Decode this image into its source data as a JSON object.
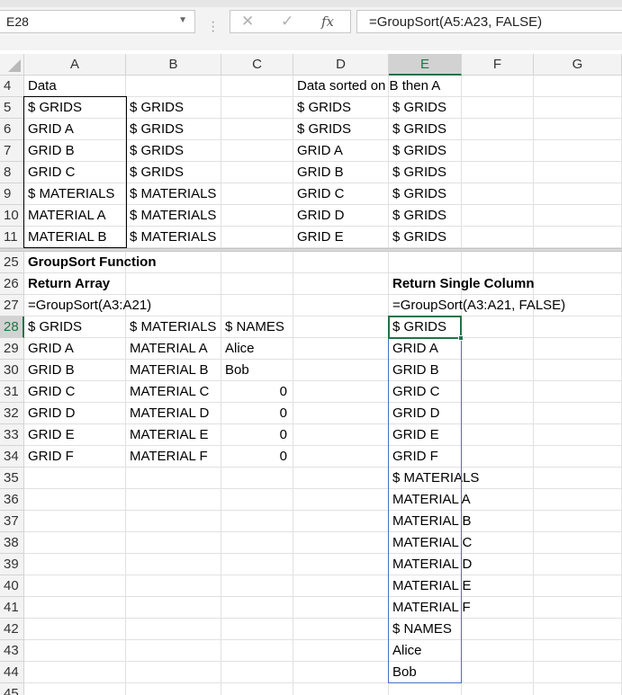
{
  "namebox": {
    "value": "E28"
  },
  "formula": {
    "text": "=GroupSort(A5:A23, FALSE)"
  },
  "toolbar": {
    "cancel": "✕",
    "enter": "✓",
    "fx": "fx"
  },
  "columns": [
    "A",
    "B",
    "C",
    "D",
    "E",
    "F",
    "G"
  ],
  "selected_column": "E",
  "selected_row": "28",
  "rows": {
    "r4": {
      "num": "4",
      "A": "Data",
      "D": "Data sorted on B then A"
    },
    "r5": {
      "num": "5",
      "A": "$ GRIDS",
      "B": "$ GRIDS",
      "D": "$ GRIDS",
      "E": "$ GRIDS"
    },
    "r6": {
      "num": "6",
      "A": "GRID A",
      "B": "$ GRIDS",
      "D": "$ GRIDS",
      "E": "$ GRIDS"
    },
    "r7": {
      "num": "7",
      "A": "GRID B",
      "B": "$ GRIDS",
      "D": "GRID A",
      "E": "$ GRIDS"
    },
    "r8": {
      "num": "8",
      "A": "GRID C",
      "B": "$ GRIDS",
      "D": "GRID B",
      "E": "$ GRIDS"
    },
    "r9": {
      "num": "9",
      "A": "$ MATERIALS",
      "B": "$ MATERIALS",
      "D": "GRID C",
      "E": "$ GRIDS"
    },
    "r10": {
      "num": "10",
      "A": "MATERIAL A",
      "B": "$ MATERIALS",
      "D": "GRID D",
      "E": "$ GRIDS"
    },
    "r11": {
      "num": "11",
      "A": "MATERIAL B",
      "B": "$ MATERIALS",
      "D": "GRID E",
      "E": "$ GRIDS"
    },
    "r25": {
      "num": "25",
      "A": "GroupSort Function"
    },
    "r26": {
      "num": "26",
      "A": "Return Array",
      "E": "Return Single Column"
    },
    "r27": {
      "num": "27",
      "A": " =GroupSort(A3:A21)",
      "E": "=GroupSort(A3:A21, FALSE)"
    },
    "r28": {
      "num": "28",
      "A": "$ GRIDS",
      "B": "$ MATERIALS",
      "C": "$ NAMES",
      "E": "$ GRIDS"
    },
    "r29": {
      "num": "29",
      "A": "GRID A",
      "B": "MATERIAL A",
      "C": "Alice",
      "E": "GRID A"
    },
    "r30": {
      "num": "30",
      "A": "GRID B",
      "B": "MATERIAL B",
      "C": "Bob",
      "E": "GRID B"
    },
    "r31": {
      "num": "31",
      "A": "GRID C",
      "B": "MATERIAL C",
      "C": "0",
      "E": "GRID C"
    },
    "r32": {
      "num": "32",
      "A": "GRID D",
      "B": "MATERIAL D",
      "C": "0",
      "E": "GRID D"
    },
    "r33": {
      "num": "33",
      "A": "GRID E",
      "B": "MATERIAL E",
      "C": "0",
      "E": "GRID E"
    },
    "r34": {
      "num": "34",
      "A": "GRID F",
      "B": "MATERIAL F",
      "C": "0",
      "E": "GRID F"
    },
    "r35": {
      "num": "35",
      "E": "$ MATERIALS"
    },
    "r36": {
      "num": "36",
      "E": "MATERIAL A"
    },
    "r37": {
      "num": "37",
      "E": "MATERIAL B"
    },
    "r38": {
      "num": "38",
      "E": "MATERIAL C"
    },
    "r39": {
      "num": "39",
      "E": "MATERIAL D"
    },
    "r40": {
      "num": "40",
      "E": "MATERIAL E"
    },
    "r41": {
      "num": "41",
      "E": "MATERIAL F"
    },
    "r42": {
      "num": "42",
      "E": "$ NAMES"
    },
    "r43": {
      "num": "43",
      "E": "Alice"
    },
    "r44": {
      "num": "44",
      "E": "Bob"
    },
    "r45": {
      "num": "45"
    }
  },
  "colors": {
    "accent": "#217346",
    "spill_border": "#4472c4"
  }
}
